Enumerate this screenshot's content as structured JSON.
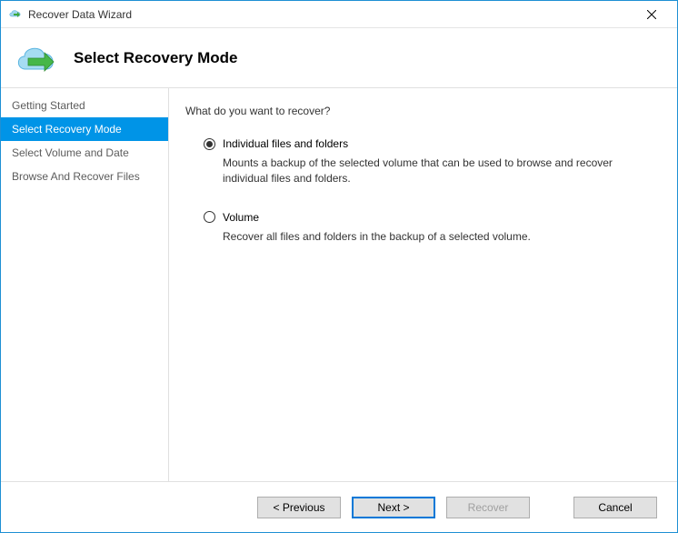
{
  "titlebar": {
    "title": "Recover Data Wizard"
  },
  "header": {
    "title": "Select Recovery Mode"
  },
  "sidebar": {
    "items": [
      {
        "label": "Getting Started",
        "active": false
      },
      {
        "label": "Select Recovery Mode",
        "active": true
      },
      {
        "label": "Select Volume and Date",
        "active": false
      },
      {
        "label": "Browse And Recover Files",
        "active": false
      }
    ]
  },
  "content": {
    "heading": "What do you want to recover?",
    "options": [
      {
        "label": "Individual files and folders",
        "description": "Mounts a backup of the selected volume that can be used to browse and recover individual files and folders.",
        "selected": true
      },
      {
        "label": "Volume",
        "description": "Recover all files and folders in the backup of a selected volume.",
        "selected": false
      }
    ]
  },
  "footer": {
    "previous": "< Previous",
    "next": "Next >",
    "recover": "Recover",
    "cancel": "Cancel"
  }
}
